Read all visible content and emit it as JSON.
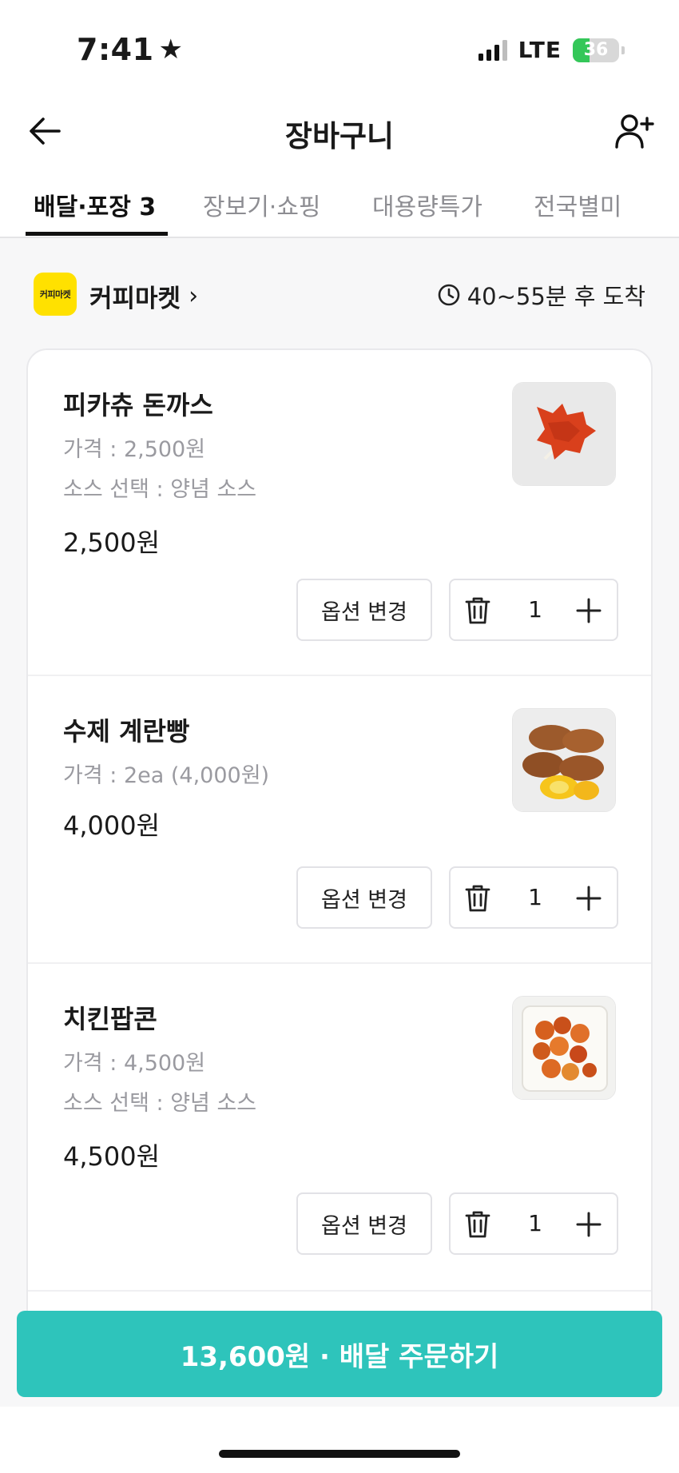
{
  "status_bar": {
    "time": "7:41",
    "network": "LTE",
    "battery": "36",
    "battery_level": 0.36
  },
  "header": {
    "title": "장바구니"
  },
  "tabs": [
    {
      "label": "배달·포장 3",
      "active": true
    },
    {
      "label": "장보기·쇼핑",
      "active": false
    },
    {
      "label": "대용량특가",
      "active": false
    },
    {
      "label": "전국별미",
      "active": false
    }
  ],
  "store": {
    "logo_text": "커피마켓",
    "name": "커피마켓",
    "eta": "40~55분 후 도착"
  },
  "items": [
    {
      "name": "피카츄 돈까스",
      "options": [
        "가격 : 2,500원",
        "소스 선택 : 양념 소스"
      ],
      "price": "2,500원",
      "option_button": "옵션 변경",
      "quantity": "1"
    },
    {
      "name": "수제 계란빵",
      "options": [
        "가격 : 2ea (4,000원)"
      ],
      "price": "4,000원",
      "option_button": "옵션 변경",
      "quantity": "1"
    },
    {
      "name": "치킨팝콘",
      "options": [
        "가격 : 4,500원",
        "소스 선택 : 양념 소스"
      ],
      "price": "4,500원",
      "option_button": "옵션 변경",
      "quantity": "1"
    }
  ],
  "order_button": "13,600원 · 배달 주문하기",
  "colors": {
    "accent": "#2ec4bb",
    "store_logo": "#ffe100",
    "battery": "#34c759"
  }
}
